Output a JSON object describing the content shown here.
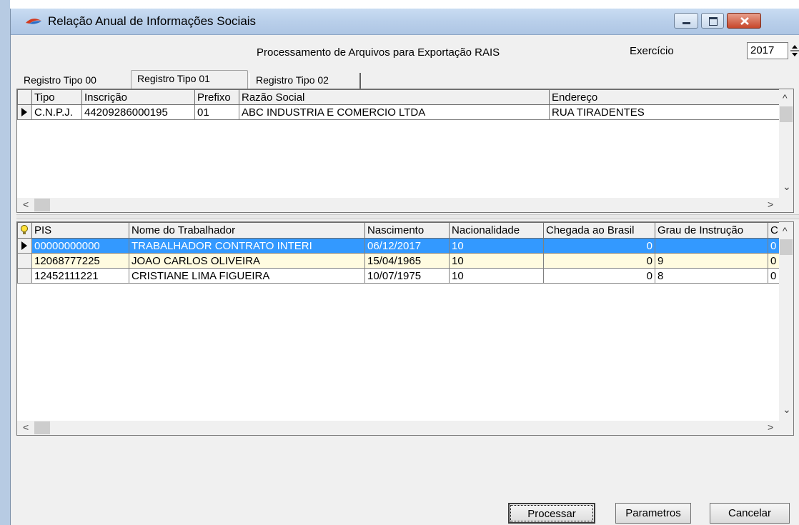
{
  "window": {
    "title": "Relação Anual de Informações Sociais"
  },
  "header": {
    "process_label": "Processamento de Arquivos para Exportação RAIS",
    "exercise_label": "Exercício",
    "year": "2017"
  },
  "tabs": [
    {
      "label": "Registro Tipo 00"
    },
    {
      "label": "Registro Tipo 01"
    },
    {
      "label": "Registro Tipo 02"
    }
  ],
  "company_grid": {
    "columns": [
      "Tipo",
      "Inscrição",
      "Prefixo",
      "Razão Social",
      "Endereço"
    ],
    "rows": [
      {
        "tipo": "C.N.P.J.",
        "inscricao": "44209286000195",
        "prefixo": "01",
        "razao": "ABC INDUSTRIA E COMERCIO LTDA",
        "endereco": "RUA TIRADENTES"
      }
    ]
  },
  "worker_grid": {
    "columns": [
      "PIS",
      "Nome do Trabalhador",
      "Nascimento",
      "Nacionalidade",
      "Chegada ao Brasil",
      "Grau de Instrução",
      "C"
    ],
    "rows": [
      {
        "pis": "00000000000",
        "nome": "TRABALHADOR CONTRATO INTERI",
        "nascimento": "06/12/2017",
        "nac": "10",
        "chegada": "0",
        "grau": "",
        "c": "0"
      },
      {
        "pis": "12068777225",
        "nome": "JOAO CARLOS OLIVEIRA",
        "nascimento": "15/04/1965",
        "nac": "10",
        "chegada": "0",
        "grau": "9",
        "c": "0"
      },
      {
        "pis": "12452111221",
        "nome": "CRISTIANE LIMA FIGUEIRA",
        "nascimento": "10/07/1975",
        "nac": "10",
        "chegada": "0",
        "grau": "8",
        "c": "0"
      }
    ]
  },
  "scroll": {
    "up": "^",
    "down": "⌄",
    "left": "<",
    "right": ">"
  },
  "footer": {
    "processar": "Processar",
    "parametros": "Parametros",
    "cancelar": "Cancelar"
  },
  "colors": {
    "selection": "#3399ff",
    "alt_row": "#fffbe0",
    "titlebar": "#c9dcf2"
  }
}
